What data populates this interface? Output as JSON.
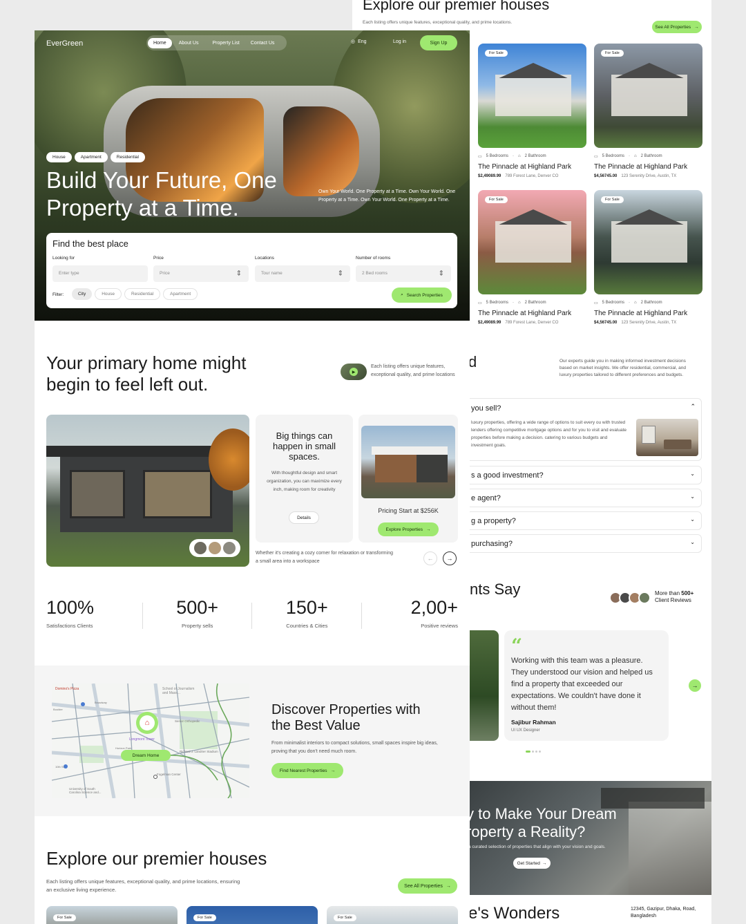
{
  "brand": "EverGreen",
  "nav": {
    "home": "Home",
    "about": "About Us",
    "list": "Property List",
    "contact": "Contact Us",
    "lang": "Eng",
    "login": "Log in",
    "signup": "Sign Up"
  },
  "hero": {
    "tags": [
      "House",
      "Apartment",
      "Residential"
    ],
    "title_line1": "Build Your Future, One",
    "title_line2": "Property at a Time.",
    "desc": "Own Your World. One Property at a Time. Own Your World. One Property at a Time. Own Your World. One Property at a Time."
  },
  "search": {
    "title": "Find the best place",
    "looking_label": "Looking for",
    "looking_ph": "Enter type",
    "price_label": "Price",
    "price_val": "Price",
    "loc_label": "Locations",
    "loc_val": "Tour name",
    "rooms_label": "Number of rooms",
    "rooms_val": "2 Bed rooms",
    "filter_label": "Filter:",
    "filters": [
      "City",
      "House",
      "Residential",
      "Apartment"
    ],
    "search_btn": "Search Properties"
  },
  "primary": {
    "title_line1": "Your primary home might",
    "title_line2": "begin to feel left out.",
    "side": "Each listing offers unique features, exceptional quality, and prime locations",
    "card_title": "Big things can happen in small spaces.",
    "card_text": "With thoughtful design and smart organization, you can maximize every inch, making room for creativity",
    "details": "Details",
    "pricing": "Pricing Start at $256K",
    "explore_btn": "Explore Properties",
    "caption": "Whether it's creating a cozy corner for relaxation or transforming a small area into a workspace"
  },
  "stats": [
    {
      "value": "100%",
      "label": "Satisfactions Clients"
    },
    {
      "value": "500+",
      "label": "Property sells"
    },
    {
      "value": "150+",
      "label": "Countries & Cities"
    },
    {
      "value": "2,00+",
      "label": "Positive reviews"
    }
  ],
  "map": {
    "labels": {
      "pizza": "Domino's Pizza",
      "school": "School of Journalism and Mass...",
      "longmont": "Longmont Tower",
      "senior": "Senior Orthopedic",
      "richard": "Richard J. Landrier Stadium",
      "park": "Horizon Park",
      "fogelman": "Fogelman Center",
      "univ": "University of South Carolina Science and...",
      "boulder": "Boulder",
      "broadway": "Broadway",
      "tenth": "10th St"
    },
    "pin_label": "Dream Home"
  },
  "discover": {
    "title_line1": "Discover Properties with",
    "title_line2": "the Best Value",
    "text": "From minimalist interiors to compact solutions, small spaces inspire big ideas, proving that you don't need much room.",
    "btn": "Find Nearest Properties"
  },
  "explore_bottom": {
    "title": "Explore our premier houses",
    "text": "Each listing offers unique features, exceptional quality, and prime locations, ensuring an exclusive living experience.",
    "btn": "See All Properties",
    "badge": "For Sale"
  },
  "right": {
    "explore_title": "Explore our premier houses",
    "explore_text": "Each listing offers unique features, exceptional quality, and prime locations.",
    "see_all": "See All Properties",
    "badge": "For Sale",
    "listings": [
      {
        "beds": "5 Bedrooms",
        "baths": "2 Bathroom",
        "name": "The Pinnacle at Highland Park",
        "price": "$2,49089.99",
        "addr": "789 Forest Lane, Denver CO"
      },
      {
        "beds": "5 Bedrooms",
        "baths": "2 Bathroom",
        "name": "The Pinnacle at Highland Park",
        "price": "$4,56745.00",
        "addr": "123 Serenity Drive, Austin, TX"
      },
      {
        "beds": "5 Bedrooms",
        "baths": "2 Bathroom",
        "name": "The Pinnacle at Highland Park",
        "price": "$2,49089.99",
        "addr": "789 Forest Lane, Denver CO"
      },
      {
        "beds": "5 Bedrooms",
        "baths": "2 Bathroom",
        "name": "The Pinnacle at Highland Park",
        "price": "$4,56745.00",
        "addr": "123 Serenity Drive, Austin, TX"
      }
    ],
    "faq_head_partial": "d",
    "faq_text": "Our experts guide you in making informed investment decisions based on market insights. We offer residential, commercial, and luxury properties tailored to different preferences and budgets.",
    "faqs": [
      {
        "q": "you sell?",
        "open": true,
        "a": "luxury properties, offering a wide range of options to suit every ou with trusted lenders offering competitive mortgage options and for you to visit and evaluate properties before making a decision. catering to various budgets and investment goals."
      },
      {
        "q": "s a good investment?",
        "open": false
      },
      {
        "q": "e agent?",
        "open": false
      },
      {
        "q": "g a property?",
        "open": false
      },
      {
        "q": "purchasing?",
        "open": false
      }
    ],
    "testimonial_title": "nts Say",
    "reviews_more": "More than ",
    "reviews_count": "500+",
    "reviews_label": "Client Reviews",
    "quote": "Working with this team was a pleasure. They understood our vision and helped us find a property that exceeded our expectations. We couldn't have done it without them!",
    "author": "Sajibur Rahman",
    "role": "UI UX Designer",
    "cta_line1": "y to Make Your Dream",
    "cta_line2": "roperty a Reality?",
    "cta_text": "a curated selection of properties that align with your vision and goals.",
    "cta_btn": "Get Started",
    "footer_title": "e's Wonders",
    "footer_addr": "12345, Gazipur, Dhaka, Road, Bangladesh"
  },
  "colors": {
    "accent": "#9fe870",
    "dark": "#1b1b1b"
  }
}
